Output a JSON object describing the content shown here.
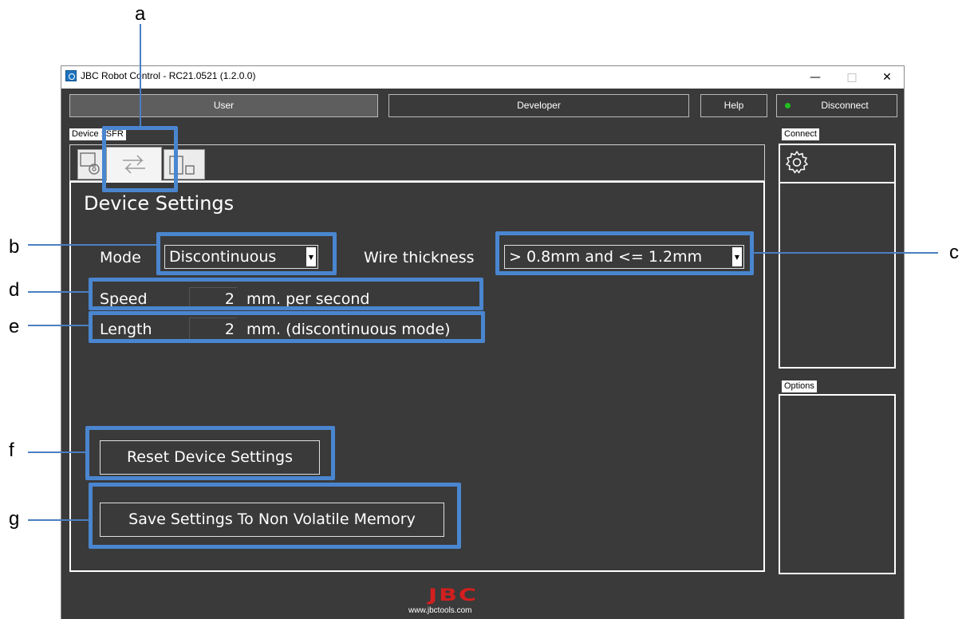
{
  "window": {
    "title": "JBC Robot Control - RC21.0521 (1.2.0.0)",
    "controls": {
      "minimize": "—",
      "maximize": "□",
      "close": "✕"
    }
  },
  "top_tabs": {
    "user": "User",
    "developer": "Developer",
    "help": "Help",
    "disconnect": "Disconnect",
    "status_color": "#22c022"
  },
  "device": {
    "group_label": "Device : SFR",
    "tabs": [
      {
        "icon": "monitor-gear-icon"
      },
      {
        "icon": "swap-arrows-icon",
        "selected": true
      },
      {
        "icon": "device-pair-icon"
      }
    ],
    "heading": "Device Settings",
    "mode": {
      "label": "Mode",
      "value": "Discontinuous"
    },
    "wire_thickness": {
      "label": "Wire thickness",
      "value": "> 0.8mm and <= 1.2mm"
    },
    "speed": {
      "label": "Speed",
      "value": "2",
      "unit": "mm. per second"
    },
    "length": {
      "label": "Length",
      "value": "2",
      "unit": "mm.  (discontinuous mode)"
    },
    "reset_button": "Reset Device Settings",
    "save_button": "Save Settings To Non Volatile Memory"
  },
  "side": {
    "connect_label": "Connect",
    "options_label": "Options"
  },
  "footer": {
    "logo": "JBC",
    "url": "www.jbctools.com"
  },
  "callouts": [
    "a",
    "b",
    "c",
    "d",
    "e",
    "f",
    "g"
  ],
  "colors": {
    "background": "#3a3a3a",
    "highlight": "#4a86cf",
    "logo_red": "#d31f1f"
  }
}
